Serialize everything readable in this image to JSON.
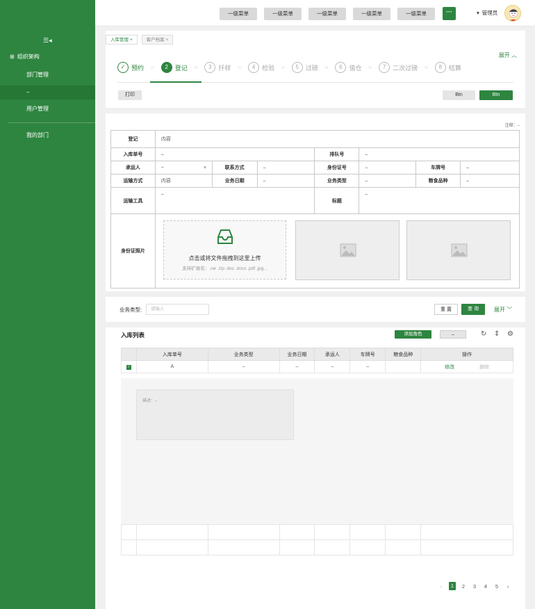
{
  "sidebar": {
    "group": "组织架构",
    "items": [
      {
        "label": "部门管理"
      },
      {
        "label": "–"
      },
      {
        "label": "用户管理"
      },
      {
        "label": "我的部门"
      }
    ]
  },
  "header": {
    "menus": [
      "一级菜单",
      "一级菜单",
      "一级菜单",
      "一级菜单",
      "一级菜单"
    ],
    "more": "···",
    "user": "管理员"
  },
  "tabs": [
    {
      "label": "入库管理"
    },
    {
      "label": "客户档案"
    }
  ],
  "expand_label": "展开",
  "steps": [
    {
      "num": "✓",
      "label": "预约"
    },
    {
      "num": "2",
      "label": "登记"
    },
    {
      "num": "3",
      "label": "扦样"
    },
    {
      "num": "4",
      "label": "检验"
    },
    {
      "num": "5",
      "label": "过磅"
    },
    {
      "num": "6",
      "label": "值仓"
    },
    {
      "num": "7",
      "label": "二次过磅"
    },
    {
      "num": "8",
      "label": "结算"
    }
  ],
  "actions": {
    "print": "打印",
    "btn1": "Btn",
    "btn2": "Btn"
  },
  "note": "注释：–",
  "form": {
    "register_label": "登记",
    "register_value": "内容",
    "order_label": "入库单号",
    "order_value": "–",
    "queue_label": "排队号",
    "queue_value": "–",
    "carrier_label": "承运人",
    "carrier_value": "–",
    "contact_label": "联系方式",
    "contact_value": "–",
    "idcard_label": "身份证号",
    "idcard_value": "–",
    "plate_label": "车牌号",
    "plate_value": "–",
    "transport_label": "运输方式",
    "transport_value": "内容",
    "date_label": "业务日期",
    "date_value": "–",
    "biztype_label": "业务类型",
    "biztype_value": "–",
    "grain_label": "粮食品种",
    "grain_value": "–",
    "tool_label": "运输工具",
    "tool_value": "–",
    "title_label": "标题",
    "title_value": "–",
    "photo_label": "身份证照片",
    "upload_text": "点击或将文件拖拽到这里上传",
    "upload_hint": "支持扩展名：.rar .zip .doc .docx .pdf .jpg..."
  },
  "filter": {
    "label": "业务类型:",
    "placeholder": "请输入",
    "reset": "重 置",
    "query": "查 询",
    "expand": "展开"
  },
  "list": {
    "title": "入库列表",
    "add": "添加角色",
    "other": "–",
    "columns": [
      "入库单号",
      "业务类型",
      "业务日期",
      "承运人",
      "车牌号",
      "粮食品种",
      "操作"
    ],
    "row": {
      "order": "A",
      "type": "–",
      "date": "–",
      "carrier": "–",
      "plate": "–",
      "grain": "",
      "edit": "修改",
      "delete": "删除"
    },
    "detail": "描述：–"
  },
  "pagination": {
    "pages": [
      "1",
      "2",
      "3",
      "4",
      "5"
    ],
    "prev": "‹",
    "next": "›"
  }
}
